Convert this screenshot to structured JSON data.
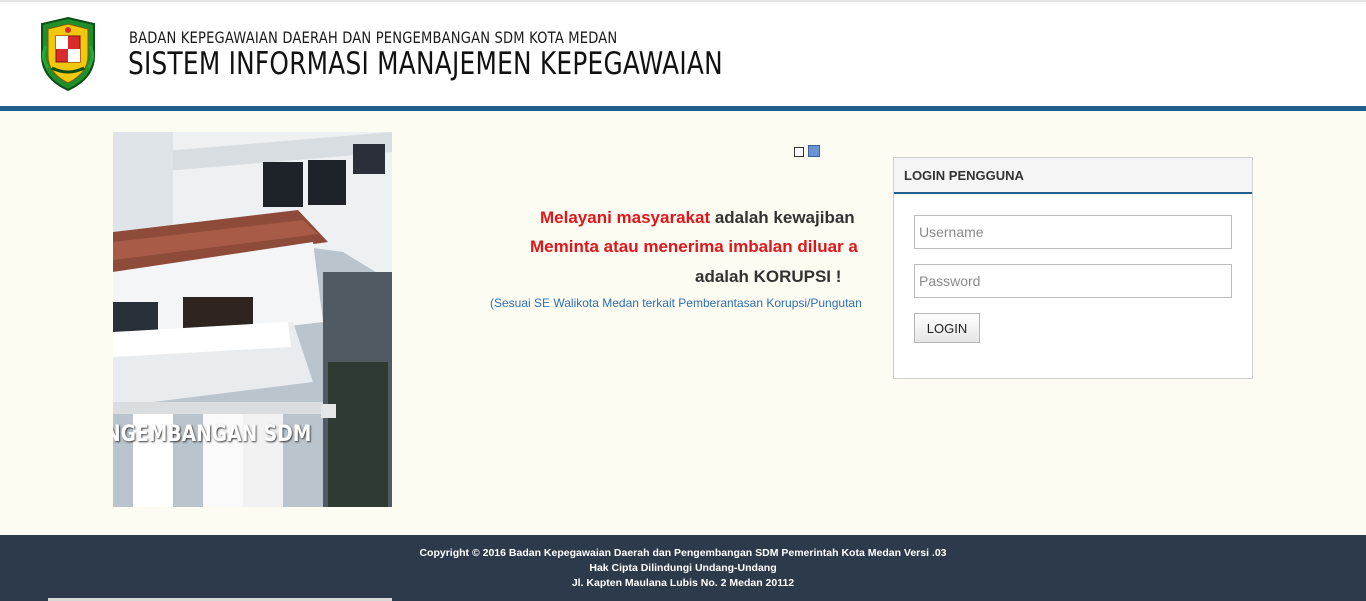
{
  "header": {
    "agency_name": "BADAN KEPEGAWAIAN DAERAH DAN PENGEMBANGAN SDM KOTA MEDAN",
    "system_name": "SISTEM INFORMASI MANAJEMEN KEPEGAWAIAN",
    "accent_color": "#1f5f8b"
  },
  "banner": {
    "photo_caption": "NGEMBANGAN SDM",
    "slides_count": 2,
    "active_slide": 2
  },
  "slogan": {
    "line1_highlight": "Melayani masyarakat",
    "line1_rest": " adalah kewajiban",
    "line2": "Meminta atau menerima imbalan diluar a",
    "line3": "adalah KORUPSI !",
    "line4": "(Sesuai SE Walikota Medan terkait Pemberantasan Korupsi/Pungutan"
  },
  "login": {
    "title": "LOGIN PENGGUNA",
    "username_placeholder": "Username",
    "password_placeholder": "Password",
    "button_label": "LOGIN"
  },
  "footer": {
    "copyright": "Copyright © 2016 Badan Kepegawaian Daerah dan Pengembangan SDM Pemerintah Kota Medan Versi .03",
    "rights": "Hak Cipta Dilindungi Undang-Undang",
    "address": "Jl. Kapten Maulana Lubis No. 2 Medan 20112"
  }
}
